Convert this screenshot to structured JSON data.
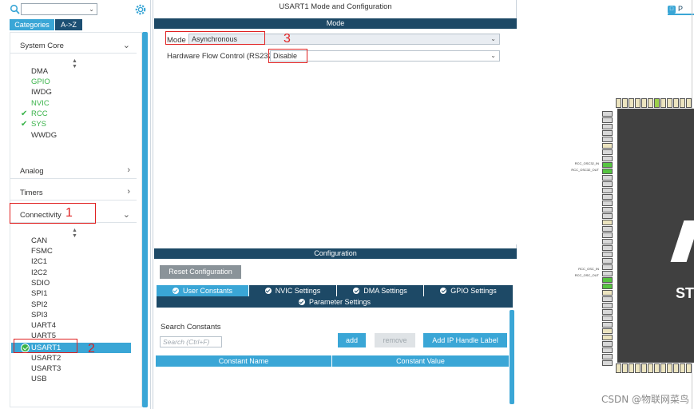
{
  "left_panel": {
    "tabs": {
      "categories": "Categories",
      "az": "A->Z"
    },
    "sections": {
      "system_core": "System Core",
      "analog": "Analog",
      "timers": "Timers",
      "connectivity": "Connectivity"
    },
    "system_core_items": [
      {
        "label": "DMA",
        "state": "normal"
      },
      {
        "label": "GPIO",
        "state": "green"
      },
      {
        "label": "IWDG",
        "state": "normal"
      },
      {
        "label": "NVIC",
        "state": "green"
      },
      {
        "label": "RCC",
        "state": "checked"
      },
      {
        "label": "SYS",
        "state": "checked"
      },
      {
        "label": "WWDG",
        "state": "normal"
      }
    ],
    "connectivity_items": [
      {
        "label": "CAN"
      },
      {
        "label": "FSMC"
      },
      {
        "label": "I2C1"
      },
      {
        "label": "I2C2"
      },
      {
        "label": "SDIO"
      },
      {
        "label": "SPI1"
      },
      {
        "label": "SPI2"
      },
      {
        "label": "SPI3"
      },
      {
        "label": "UART4"
      },
      {
        "label": "UART5"
      },
      {
        "label": "USART1",
        "selected": true
      },
      {
        "label": "USART2"
      },
      {
        "label": "USART3"
      },
      {
        "label": "USB"
      }
    ]
  },
  "annotations": {
    "n1": "1",
    "n2": "2",
    "n3": "3"
  },
  "middle_panel": {
    "title": "USART1 Mode and Configuration",
    "mode_header": "Mode",
    "mode_label": "Mode",
    "mode_value": "Asynchronous",
    "hfc_label": "Hardware Flow Control (RS232)",
    "hfc_value": "Disable",
    "config_header": "Configuration",
    "reset_button": "Reset Configuration",
    "tabs": [
      "User Constants",
      "NVIC Settings",
      "DMA Settings",
      "GPIO Settings"
    ],
    "params_tab": "Parameter Settings",
    "search_label": "Search Constants",
    "search_placeholder": "Search (Ctrl+F)",
    "add_button": "add",
    "remove_button": "remove",
    "add_ip_button": "Add IP Handle Label",
    "table_columns": [
      "Constant Name",
      "Constant Value"
    ]
  },
  "right_panel": {
    "tab_label": "P",
    "chip_text": "ST",
    "pin_labels": {
      "osc32_in": "RCC_OSC32_IN",
      "osc32_out": "RCC_OSC32_OUT",
      "osc_in": "RCC_OSC_IN",
      "osc_out": "RCC_OSC_OUT"
    }
  },
  "watermark": "CSDN @物联网菜鸟",
  "colors": {
    "accent": "#3aa6d6",
    "dark": "#1d4966",
    "green": "#3ab34a",
    "annotation_red": "#e02020"
  }
}
